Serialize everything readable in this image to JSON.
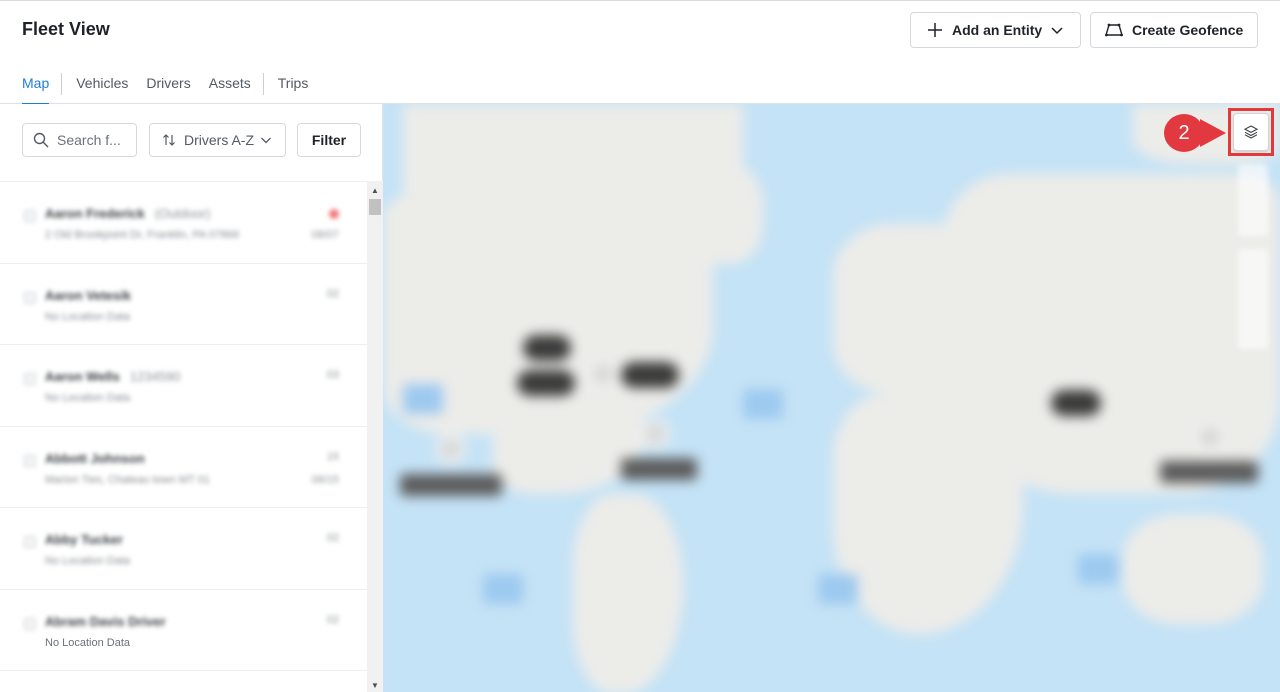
{
  "header": {
    "title": "Fleet View",
    "add_entity_label": "Add an Entity",
    "create_geofence_label": "Create Geofence"
  },
  "tabs": [
    {
      "label": "Map",
      "active": true
    },
    {
      "label": "Vehicles",
      "active": false
    },
    {
      "label": "Drivers",
      "active": false
    },
    {
      "label": "Assets",
      "active": false
    },
    {
      "label": "Trips",
      "active": false
    }
  ],
  "sidebar": {
    "search_placeholder": "Search f...",
    "sort_label": "Drivers A-Z",
    "filter_label": "Filter",
    "items": [
      {
        "name": "Aaron Frederick",
        "extra": "(Outdoor)",
        "location": "2 Old Brookpoint Dr, Franklin, PA 07866",
        "right": "",
        "right2": "08/07"
      },
      {
        "name": "Aaron Vetesik",
        "extra": "",
        "location": "No Location Data",
        "right": "02",
        "right2": ""
      },
      {
        "name": "Aaron Wells",
        "extra": "1234590",
        "location": "No Location Data",
        "right": "03",
        "right2": ""
      },
      {
        "name": "Abbott Johnson",
        "extra": "",
        "location": "Marion Ties, Chateau town MT 01",
        "right": "15",
        "right2": "08/15"
      },
      {
        "name": "Abby Tucker",
        "extra": "",
        "location": "No Location Data",
        "right": "02",
        "right2": ""
      },
      {
        "name": "Abram Davis Driver",
        "extra": "",
        "location": "No Location Data",
        "right": "02",
        "right2": ""
      }
    ]
  },
  "map": {
    "callout_number": "2",
    "layers_icon": "layers-icon"
  },
  "colors": {
    "accent": "#1f7fd7",
    "callout": "#e2383f",
    "ocean": "#c5e3f6"
  }
}
